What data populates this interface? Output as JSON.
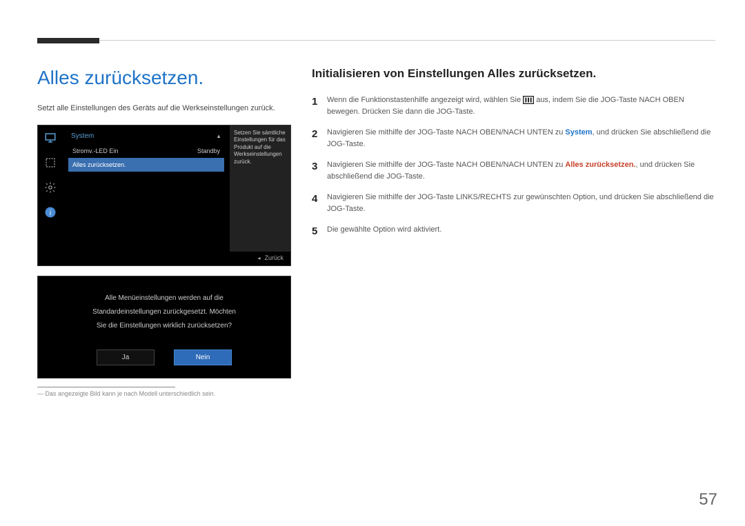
{
  "page_number": "57",
  "left": {
    "heading": "Alles zurücksetzen.",
    "description": "Setzt alle Einstellungen des Geräts auf die Werkseinstellungen zurück.",
    "osd": {
      "title": "System",
      "row1_label": "Stromv.-LED Ein",
      "row1_value": "Standby",
      "row2_label": "Alles zurücksetzen.",
      "desc": "Setzen Sie sämtliche Einstellungen für das Produkt auf die Werkseinstellungen zurück.",
      "back": "Zurück"
    },
    "confirm": {
      "line1": "Alle Menüeinstellungen werden auf die",
      "line2": "Standardeinstellungen zurückgesetzt. Möchten",
      "line3": "Sie die Einstellungen wirklich zurücksetzen?",
      "yes": "Ja",
      "no": "Nein"
    },
    "note_prefix": "―",
    "note": "Das angezeigte Bild kann je nach Modell unterschiedlich sein."
  },
  "right": {
    "heading": "Initialisieren von Einstellungen Alles zurücksetzen.",
    "steps": {
      "s1": {
        "num": "1",
        "pre": "Wenn die Funktionstastenhilfe angezeigt wird, wählen Sie ",
        "post": " aus, indem Sie die JOG-Taste NACH OBEN bewegen. Drücken Sie dann die JOG-Taste."
      },
      "s2": {
        "num": "2",
        "pre": "Navigieren Sie mithilfe der JOG-Taste NACH OBEN/NACH UNTEN zu ",
        "hl": "System",
        "post": ", und drücken Sie abschließend die JOG-Taste."
      },
      "s3": {
        "num": "3",
        "pre": "Navigieren Sie mithilfe der JOG-Taste NACH OBEN/NACH UNTEN zu ",
        "hl": "Alles zurücksetzen.",
        "post": ", und drücken Sie abschließend die JOG-Taste."
      },
      "s4": {
        "num": "4",
        "text": "Navigieren Sie mithilfe der JOG-Taste LINKS/RECHTS zur gewünschten Option, und drücken Sie abschließend die JOG-Taste."
      },
      "s5": {
        "num": "5",
        "text": "Die gewählte Option wird aktiviert."
      }
    }
  }
}
